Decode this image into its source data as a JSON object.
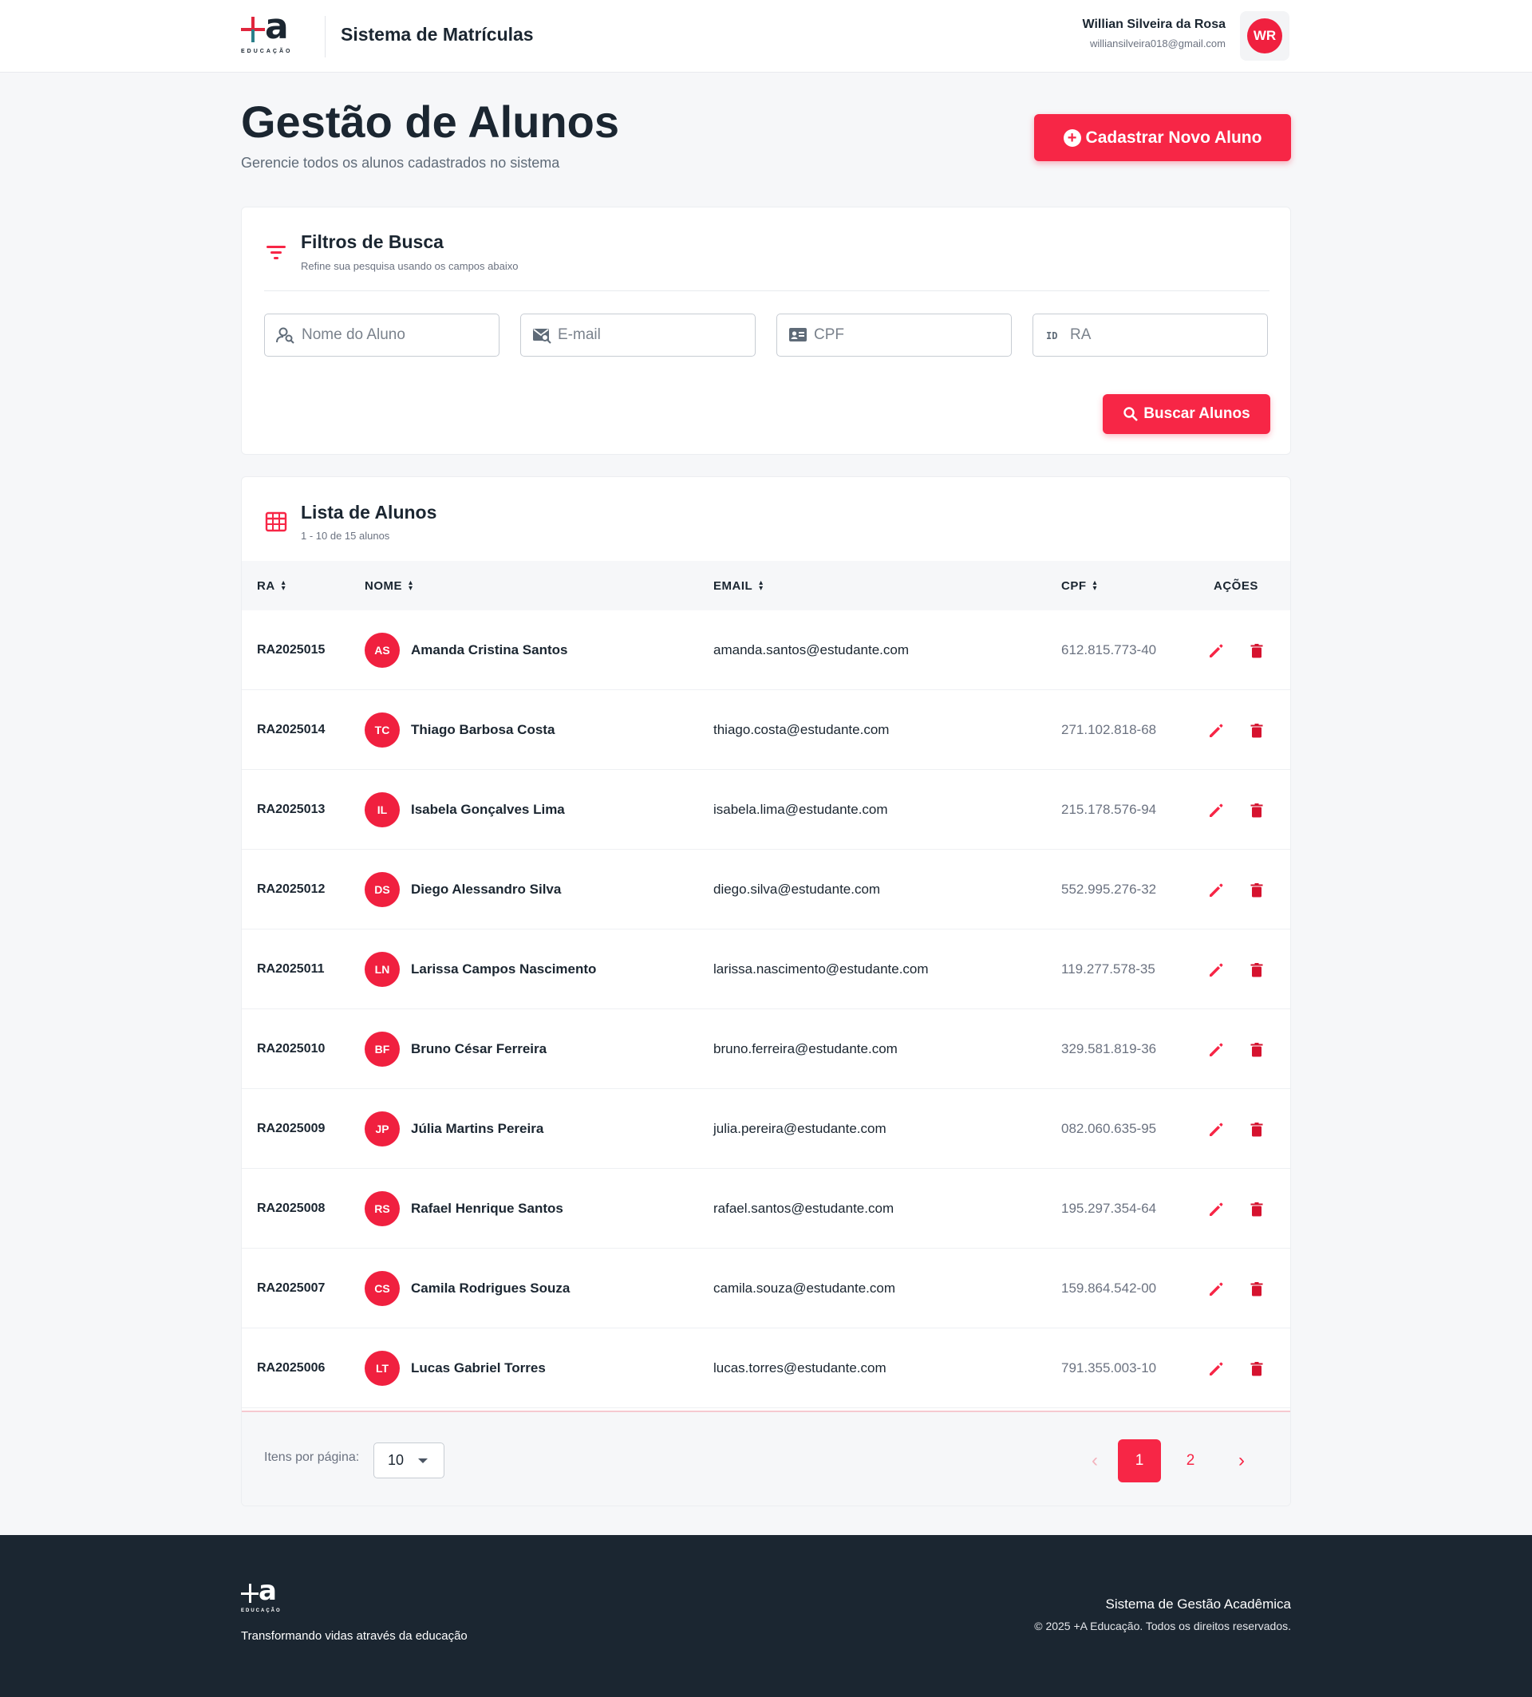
{
  "header": {
    "logo_sub": "EDUCAÇÃO",
    "app_title": "Sistema de Matrículas",
    "user_name": "Willian Silveira da Rosa",
    "user_email": "williansilveira018@gmail.com",
    "user_initials": "WR"
  },
  "page": {
    "title": "Gestão de Alunos",
    "subtitle": "Gerencie todos os alunos cadastrados no sistema",
    "new_button": "Cadastrar Novo Aluno"
  },
  "filters": {
    "title": "Filtros de Busca",
    "subtitle": "Refine sua pesquisa usando os campos abaixo",
    "name_placeholder": "Nome do Aluno",
    "email_placeholder": "E-mail",
    "cpf_placeholder": "CPF",
    "ra_placeholder": "RA",
    "search_button": "Buscar Alunos"
  },
  "list": {
    "title": "Lista de Alunos",
    "subtitle": "1 - 10 de 15 alunos",
    "columns": [
      "RA",
      "NOME",
      "EMAIL",
      "CPF",
      "AÇÕES"
    ],
    "rows": [
      {
        "ra": "RA2025015",
        "initials": "AS",
        "name": "Amanda Cristina Santos",
        "email": "amanda.santos@estudante.com",
        "cpf": "612.815.773-40"
      },
      {
        "ra": "RA2025014",
        "initials": "TC",
        "name": "Thiago Barbosa Costa",
        "email": "thiago.costa@estudante.com",
        "cpf": "271.102.818-68"
      },
      {
        "ra": "RA2025013",
        "initials": "IL",
        "name": "Isabela Gonçalves Lima",
        "email": "isabela.lima@estudante.com",
        "cpf": "215.178.576-94"
      },
      {
        "ra": "RA2025012",
        "initials": "DS",
        "name": "Diego Alessandro Silva",
        "email": "diego.silva@estudante.com",
        "cpf": "552.995.276-32"
      },
      {
        "ra": "RA2025011",
        "initials": "LN",
        "name": "Larissa Campos Nascimento",
        "email": "larissa.nascimento@estudante.com",
        "cpf": "119.277.578-35"
      },
      {
        "ra": "RA2025010",
        "initials": "BF",
        "name": "Bruno César Ferreira",
        "email": "bruno.ferreira@estudante.com",
        "cpf": "329.581.819-36"
      },
      {
        "ra": "RA2025009",
        "initials": "JP",
        "name": "Júlia Martins Pereira",
        "email": "julia.pereira@estudante.com",
        "cpf": "082.060.635-95"
      },
      {
        "ra": "RA2025008",
        "initials": "RS",
        "name": "Rafael Henrique Santos",
        "email": "rafael.santos@estudante.com",
        "cpf": "195.297.354-64"
      },
      {
        "ra": "RA2025007",
        "initials": "CS",
        "name": "Camila Rodrigues Souza",
        "email": "camila.souza@estudante.com",
        "cpf": "159.864.542-00"
      },
      {
        "ra": "RA2025006",
        "initials": "LT",
        "name": "Lucas Gabriel Torres",
        "email": "lucas.torres@estudante.com",
        "cpf": "791.355.003-10"
      }
    ]
  },
  "pagination": {
    "per_page_label": "Itens por página:",
    "per_page_value": "10",
    "prev": "‹",
    "pages": [
      "1",
      "2"
    ],
    "next": "›"
  },
  "footer": {
    "logo_sub": "EDUCAÇÃO",
    "tagline": "Transformando vidas através da educação",
    "system": "Sistema de Gestão Acadêmica",
    "copyright": "© 2025 +A Educação. Todos os direitos reservados."
  },
  "colors": {
    "accent": "#f72646",
    "dark": "#1b2631",
    "background": "#f6f7f9"
  },
  "icons": {
    "filter": "filter-icon",
    "table": "table-grid-icon",
    "edit": "pencil-icon",
    "delete": "trash-icon",
    "search": "search-icon",
    "add": "plus-circle-icon"
  }
}
